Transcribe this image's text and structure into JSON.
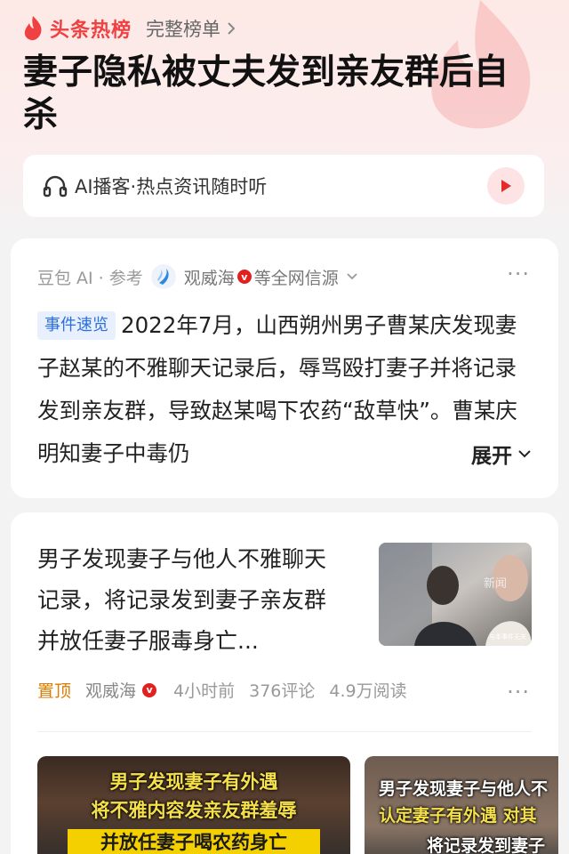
{
  "header": {
    "brand": "头条热榜",
    "full_list": "完整榜单",
    "headline": "妻子隐私被丈夫发到亲友群后自杀"
  },
  "podcast": {
    "text": "AI播客·热点资讯随时听"
  },
  "ai_card": {
    "source_prefix": "豆包 AI · 参考",
    "source_name": "观威海",
    "source_suffix": "等全网信源",
    "more": "···",
    "tag": "事件速览",
    "summary": "2022年7月，山西朔州男子曹某庆发现妻子赵某的不雅聊天记录后，辱骂殴打妻子并将记录发到亲友群，导致赵某喝下农药“敌草快”。曹某庆明知妻子中毒仍",
    "expand": "展开"
  },
  "news_card": {
    "title": "男子发现妻子与他人不雅聊天记录，将记录发到妻子亲友群并放任妻子服毒身亡...",
    "pin": "置顶",
    "author": "观威海",
    "time": "4小时前",
    "comments": "376评论",
    "reads": "4.9万阅读",
    "more": "···",
    "thumb_watermark": "新闻",
    "thumb_note": "与本事件无关",
    "videos": [
      {
        "line1": "男子发现妻子有外遇",
        "line2": "将不雅内容发亲友群羞辱",
        "line3": "并放任妻子喝农药身亡"
      },
      {
        "line1": "男子发现妻子与他人不",
        "line2": "认定妻子有外遇 对其",
        "line3": "将记录发到妻子"
      }
    ]
  },
  "icons": [
    "flame-icon",
    "chevron-right-icon",
    "headphones-icon",
    "play-icon",
    "doubao-logo-icon",
    "verified-icon",
    "chevron-down-icon"
  ],
  "colors": {
    "brand_red": "#f04142",
    "tag_blue": "#2b6fe0",
    "pin_orange": "#e07b00"
  }
}
